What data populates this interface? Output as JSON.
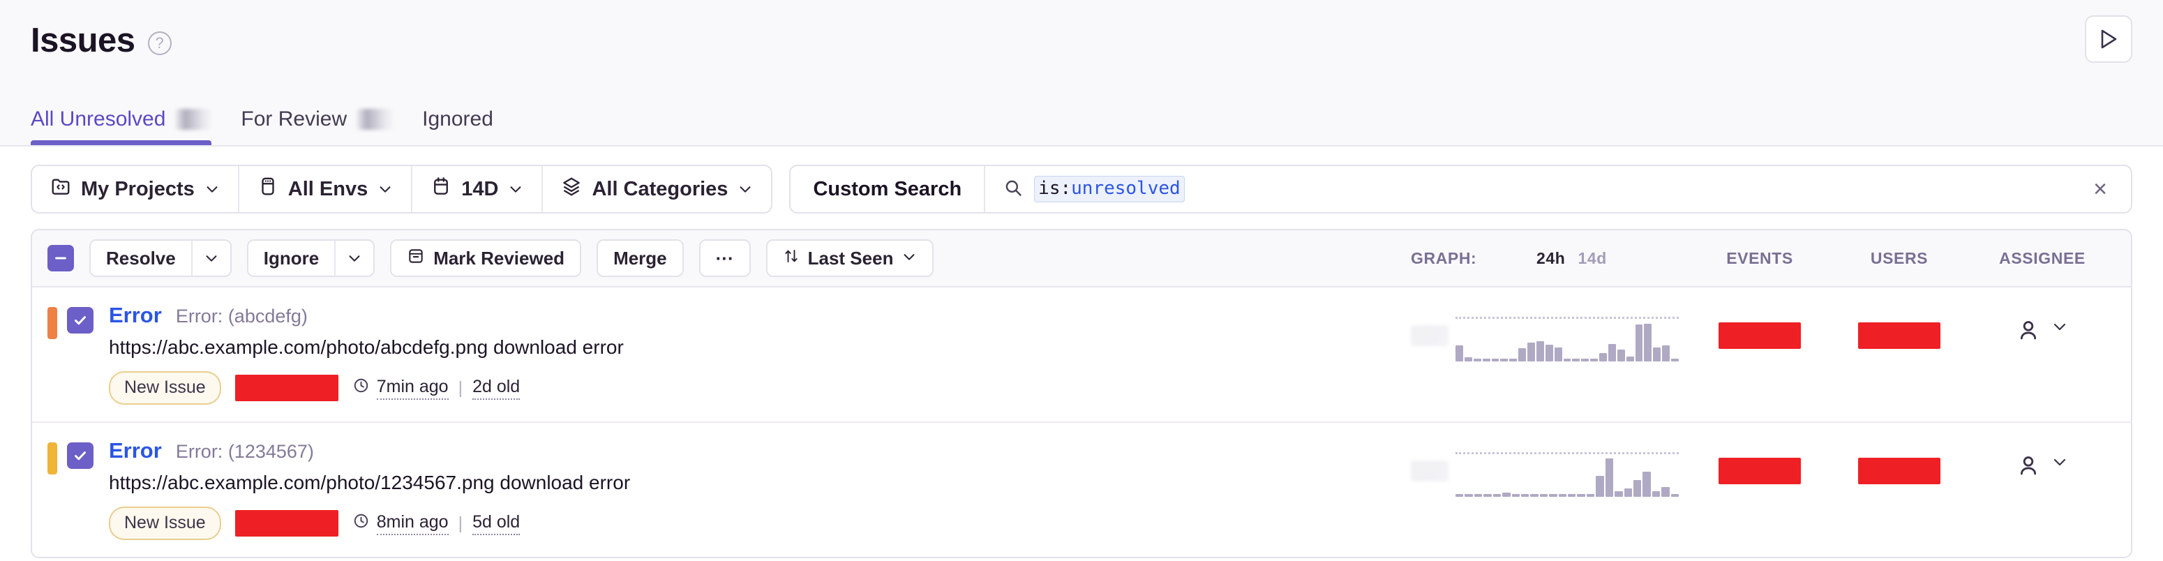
{
  "header": {
    "title": "Issues",
    "help_icon": "question-circle-icon",
    "play_button_icon": "play-triangle-icon"
  },
  "tabs": [
    {
      "label": "All Unresolved",
      "badge_redacted": true,
      "active": true
    },
    {
      "label": "For Review",
      "badge_redacted": true,
      "active": false
    },
    {
      "label": "Ignored",
      "badge_redacted": false,
      "active": false
    }
  ],
  "filters": [
    {
      "label": "My Projects",
      "icon": "project-folder-icon",
      "chevron": "chevron-down-icon"
    },
    {
      "label": "All Envs",
      "icon": "server-icon",
      "chevron": "chevron-down-icon"
    },
    {
      "label": "14D",
      "icon": "calendar-icon",
      "chevron": "chevron-down-icon"
    },
    {
      "label": "All Categories",
      "icon": "layers-icon",
      "chevron": "chevron-down-icon"
    }
  ],
  "search": {
    "custom_search_label": "Custom Search",
    "icon": "search-icon",
    "token_key": "is:",
    "token_value": "unresolved",
    "clear_label": "×",
    "clear_icon": "close-icon"
  },
  "toolbar": {
    "select_all_state": "indeterminate",
    "resolve_label": "Resolve",
    "ignore_label": "Ignore",
    "mark_reviewed_label": "Mark Reviewed",
    "mark_reviewed_icon": "archive-icon",
    "merge_label": "Merge",
    "more_label": "···",
    "sort_label": "Last Seen",
    "sort_icon": "sort-updown-icon"
  },
  "columns": {
    "graph_label": "GRAPH:",
    "graph_24h": "24h",
    "graph_14d": "14d",
    "graph_selected": "24h",
    "events": "EVENTS",
    "users": "USERS",
    "assignee": "ASSIGNEE"
  },
  "colors": {
    "accent_purple": "#6C5FC7",
    "link_blue": "#2B55E5",
    "redaction_red": "#EE2025",
    "level_orange": "#EE7F45",
    "level_amber": "#F0B537",
    "spark_bar": "#B0A9C4"
  },
  "issues": [
    {
      "level_color": "#EE7F45",
      "checked": true,
      "type": "Error",
      "culprit": "Error: (abcdefg)",
      "message": "https://abc.example.com/photo/abcdefg.png download error",
      "badge": "New Issue",
      "meta_redacted": true,
      "clock_icon": "clock-icon",
      "last_seen": "7min ago",
      "age": "2d old",
      "events_redacted": true,
      "users_redacted": true,
      "assignee_icon": "user-icon",
      "assignee_chevron": "chevron-down-icon",
      "sparkline": [
        38,
        10,
        5,
        5,
        5,
        5,
        5,
        32,
        45,
        48,
        40,
        34,
        6,
        6,
        6,
        6,
        20,
        42,
        28,
        12,
        88,
        90,
        34,
        38,
        5
      ]
    },
    {
      "level_color": "#F0B537",
      "checked": true,
      "type": "Error",
      "culprit": "Error: (1234567)",
      "message": "https://abc.example.com/photo/1234567.png download error",
      "badge": "New Issue",
      "meta_redacted": true,
      "clock_icon": "clock-icon",
      "last_seen": "8min ago",
      "age": "5d old",
      "events_redacted": true,
      "users_redacted": true,
      "assignee_icon": "user-icon",
      "assignee_chevron": "chevron-down-icon",
      "sparkline": [
        5,
        5,
        5,
        5,
        5,
        10,
        5,
        5,
        5,
        5,
        5,
        5,
        5,
        5,
        5,
        50,
        92,
        14,
        20,
        40,
        60,
        14,
        24,
        6
      ]
    }
  ]
}
